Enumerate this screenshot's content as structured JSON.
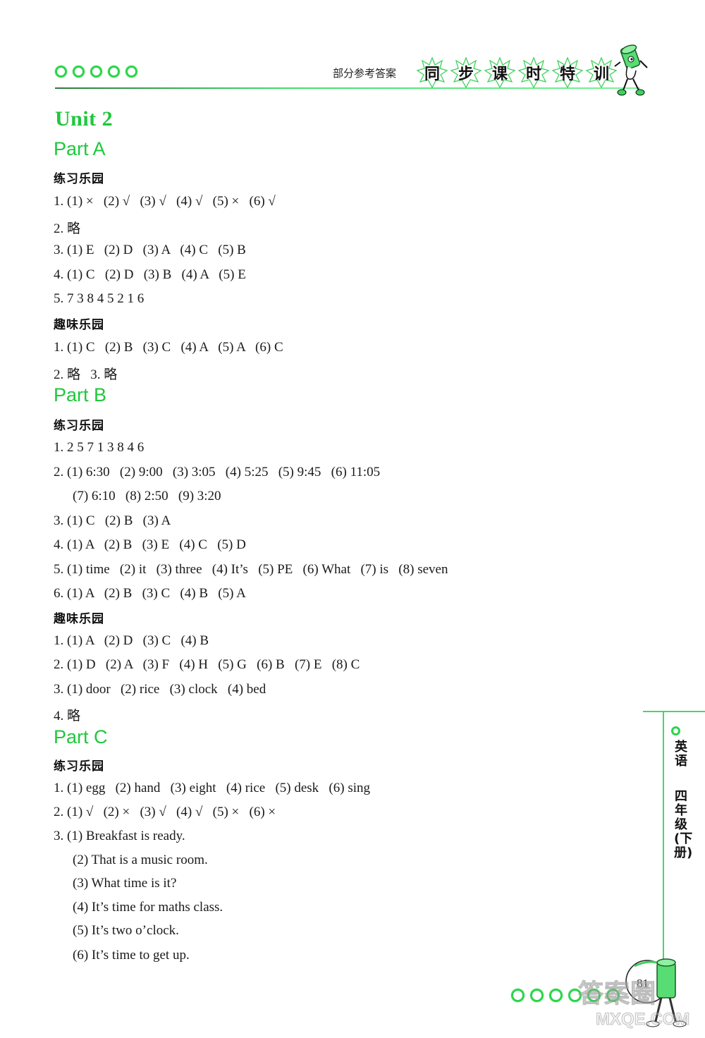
{
  "header": {
    "label": "部分参考答案",
    "series_title_chars": [
      "同",
      "步",
      "课",
      "时",
      "特",
      "训"
    ],
    "accent_color": "#1ec83c"
  },
  "unit_title": "Unit 2",
  "parts": {
    "a": {
      "title": "Part A",
      "practice_title": "练习乐园",
      "practice": [
        "1. (1) ×   (2) √   (3) √   (4) √   (5) ×   (6) √",
        "2. 略",
        "3. (1) E   (2) D   (3) A   (4) C   (5) B",
        "4. (1) C   (2) D   (3) B   (4) A   (5) E",
        "5. 7 3 8 4 5 2 1 6"
      ],
      "fun_title": "趣味乐园",
      "fun": [
        "1. (1) C   (2) B   (3) C   (4) A   (5) A   (6) C",
        "2. 略   3. 略"
      ]
    },
    "b": {
      "title": "Part B",
      "practice_title": "练习乐园",
      "practice": [
        "1. 2 5 7 1 3 8 4 6",
        "2. (1) 6:30   (2) 9:00   (3) 3:05   (4) 5:25   (5) 9:45   (6) 11:05",
        "(7) 6:10   (8) 2:50   (9) 3:20",
        "3. (1) C   (2) B   (3) A",
        "4. (1) A   (2) B   (3) E   (4) C   (5) D",
        "5. (1) time   (2) it   (3) three   (4) It’s   (5) PE   (6) What   (7) is   (8) seven",
        "6. (1) A   (2) B   (3) C   (4) B   (5) A"
      ],
      "fun_title": "趣味乐园",
      "fun": [
        "1. (1) A   (2) D   (3) C   (4) B",
        "2. (1) D   (2) A   (3) F   (4) H   (5) G   (6) B   (7) E   (8) C",
        "3. (1) door   (2) rice   (3) clock   (4) bed",
        "4. 略"
      ]
    },
    "c": {
      "title": "Part C",
      "practice_title": "练习乐园",
      "practice": [
        "1. (1) egg   (2) hand   (3) eight   (4) rice   (5) desk   (6) sing",
        "2. (1) √   (2) ×   (3) √   (4) √   (5) ×   (6) ×",
        "3. (1) Breakfast is ready.",
        "(2) That is a music room.",
        "(3) What time is it?",
        "(4) It’s time for maths class.",
        "(5) It’s two o’clock.",
        "(6) It’s time to get up."
      ]
    }
  },
  "side_tab": {
    "subject": "英语",
    "grade": "四年级(下册)"
  },
  "footer": {
    "page_number": "81",
    "watermark": "答案圈",
    "watermark_url_text": "MXQE.COM"
  }
}
